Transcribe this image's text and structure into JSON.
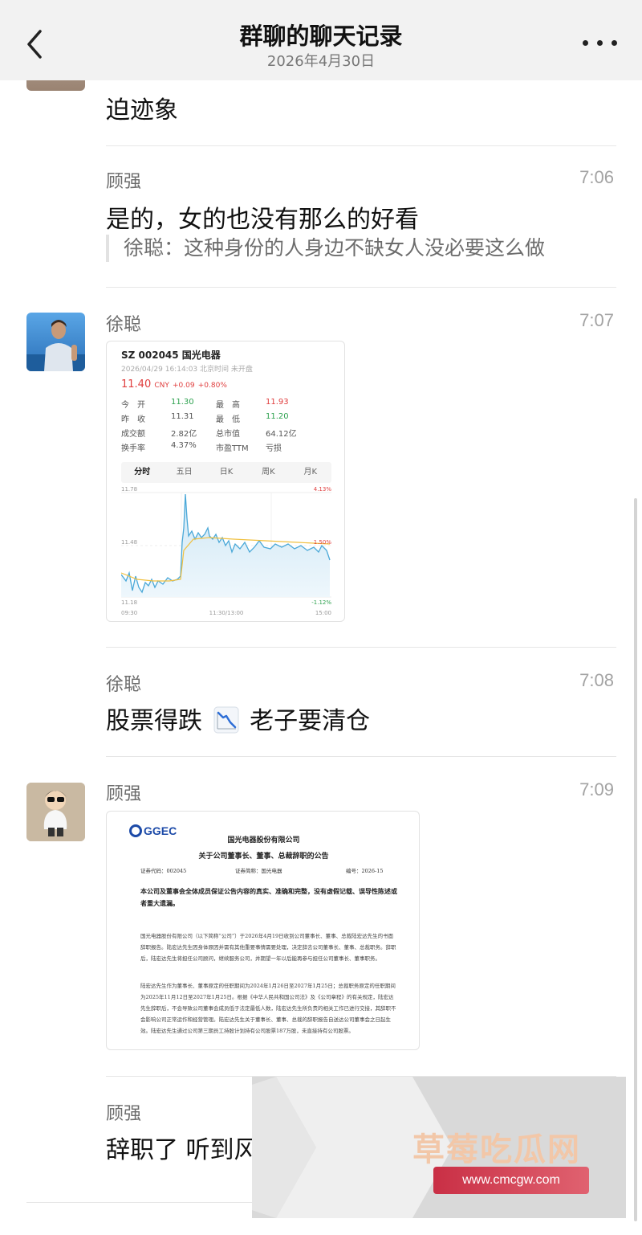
{
  "header": {
    "title": "群聊的聊天记录",
    "date": "2026年4月30日"
  },
  "messages": [
    {
      "text": "迫迹象"
    },
    {
      "sender": "顾强",
      "time": "7:06",
      "text": "是的，女的也没有那么的好看",
      "quote": "徐聪：这种身份的人身边不缺女人没必要这么做"
    },
    {
      "sender": "徐聪",
      "time": "7:07"
    },
    {
      "sender": "徐聪",
      "time": "7:08",
      "text_before": "股票得跌",
      "emoji": "chart-decreasing",
      "text_after": "老子要清仓"
    },
    {
      "sender": "顾强",
      "time": "7:09"
    },
    {
      "sender": "顾强",
      "text": "辞职了 听到风"
    }
  ],
  "stock": {
    "title": "SZ 002045  国光电器",
    "subtitle": "2026/04/29 16:14:03 北京时间 未开盘",
    "price": "11.40",
    "currency": "CNY",
    "change": "+0.09",
    "change_pct": "+0.80%",
    "rows": [
      {
        "l1": "今　开",
        "v1": "11.30",
        "l2": "最　高",
        "v2": "11.93"
      },
      {
        "l1": "昨　收",
        "v1": "11.31",
        "l2": "最　低",
        "v2": "11.20"
      },
      {
        "l1": "成交额",
        "v1": "2.82亿",
        "l2": "总市值",
        "v2": "64.12亿"
      },
      {
        "l1": "换手率",
        "v1": "4.37%",
        "l2": "市盈TTM",
        "v2": "亏损"
      }
    ],
    "tabs": [
      "分时",
      "五日",
      "日K",
      "周K",
      "月K"
    ],
    "axis": {
      "y_top": "11.78",
      "y_mid": "11.48",
      "y_bot": "11.18",
      "pct_top": "4.13%",
      "pct_mid": "1.50%",
      "pct_bot": "-1.12%",
      "x_start": "09:30",
      "x_mid": "11:30/13:00",
      "x_end": "15:00"
    },
    "colors": {
      "up": "#e03e3e",
      "down": "#2ea24f",
      "line": "#4aa8d8",
      "avg": "#f0c040"
    }
  },
  "doc": {
    "logo": "GGEC",
    "company": "国光电器股份有限公司",
    "heading": "关于公司董事长、董事、总裁辞职的公告",
    "code": "证券代码：002045",
    "short": "证券简称：国光电器",
    "number": "编号：2026-15",
    "bold": "本公司及董事会全体成员保证公告内容的真实、准确和完整，没有虚假记载、误导性陈述或者重大遗漏。",
    "para1": "国光电器股份有限公司（以下简称“公司”）于2026年4月19日收到公司董事长、董事、总裁陆宏达先生的书面辞职报告。陆宏达先生因身体原因并需有其他重要事情需要处理，决定辞去公司董事长、董事、总裁职务。辞职后，陆宏达先生将担任公司顾问，继续服务公司，并期望一年以后能再参与担任公司董事长、董事职务。",
    "para2": "陆宏达先生作为董事长、董事原定的任职期间为2024年1月26日至2027年1月25日；总裁职务原定的任职期间为2025年11月12日至2027年1月25日。根据《中华人民共和国公司法》及《公司章程》的有关规定，陆宏达先生辞职后，不会导致公司董事会成员低于法定最低人数，陆宏达先生所负责的相关工作已进行交接，其辞职不会影响公司正常运作和经营管理。陆宏达先生关于董事长、董事、总裁的辞职报告自送达公司董事会之日起生效。陆宏达先生通过公司第三期员工持股计划持有公司股票187万股，未直接持有公司股票。"
  },
  "watermark": {
    "brand": "草莓吃瓜网",
    "url": "www.cmcgw.com"
  }
}
